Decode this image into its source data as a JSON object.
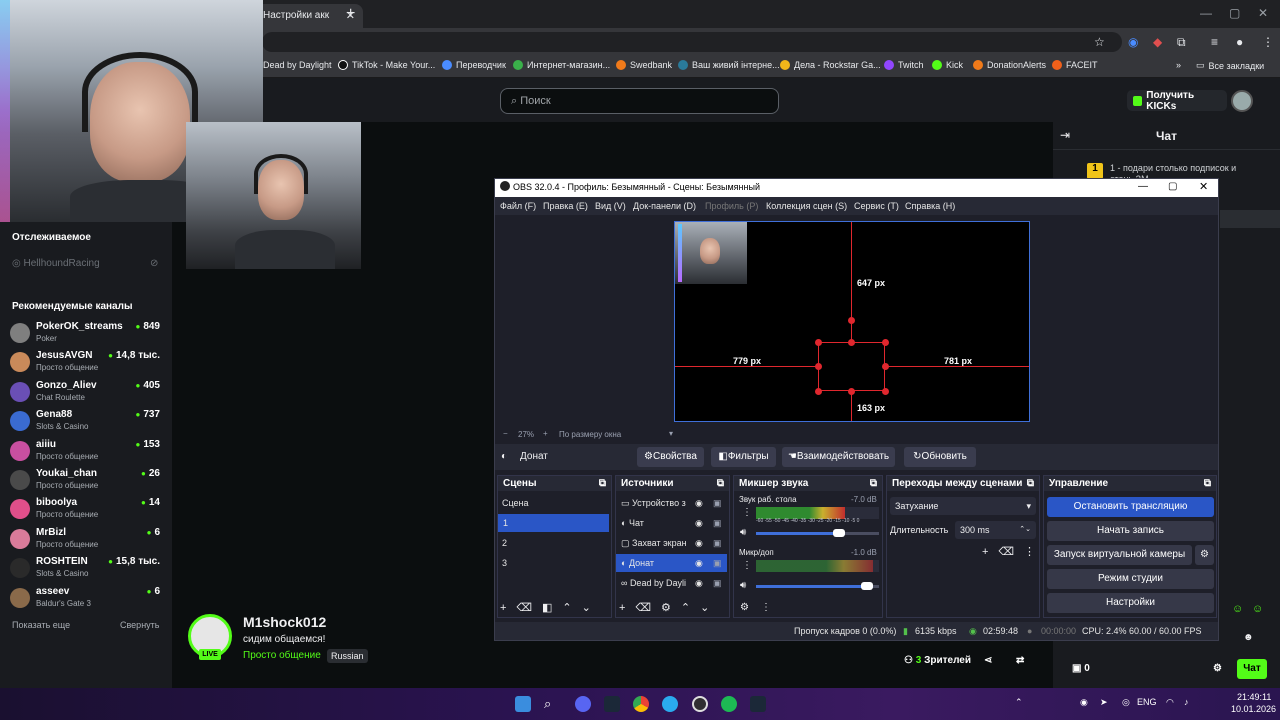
{
  "browser": {
    "tab_title": "Настройки акк",
    "new_tab": "+",
    "bookmarks": [
      "Dead by Daylight",
      "TikTok - Make Your...",
      "Переводчик",
      "Интернет-магазин...",
      "Swedbank",
      "Ваш живий інтерне...",
      "Дела - Rockstar Ga...",
      "Twitch",
      "Kick",
      "DonationAlerts",
      "FACEIT"
    ],
    "all_bookmarks": "Все закладки",
    "bookmarks_more": "»"
  },
  "kick": {
    "search_placeholder": "Поиск",
    "kicks_button": "Получить KICKs",
    "followed_title": "Отслеживаемое",
    "followed": [
      {
        "name": "HellhoundRacing"
      }
    ],
    "recommended_title": "Рекомендуемые каналы",
    "channels": [
      {
        "name": "PokerOK_streams",
        "category": "Poker",
        "viewers": "849",
        "color": "#7f7f7f"
      },
      {
        "name": "JesusAVGN",
        "category": "Просто общение",
        "viewers": "14,8 тыс.",
        "color": "#c98a5a"
      },
      {
        "name": "Gonzo_Aliev",
        "category": "Chat Roulette",
        "viewers": "405",
        "color": "#6a4fb5"
      },
      {
        "name": "Gena88",
        "category": "Slots & Casino",
        "viewers": "737",
        "color": "#3a6bd1"
      },
      {
        "name": "aiiiu",
        "category": "Просто общение",
        "viewers": "153",
        "color": "#c94fa0"
      },
      {
        "name": "Youkai_chan",
        "category": "Просто общение",
        "viewers": "26",
        "color": "#4a4a4a"
      },
      {
        "name": "biboolya",
        "category": "Просто общение",
        "viewers": "14",
        "color": "#e04f8a"
      },
      {
        "name": "MrBizl",
        "category": "Просто общение",
        "viewers": "6",
        "color": "#d97b9a"
      },
      {
        "name": "ROSHTEIN",
        "category": "Slots & Casino",
        "viewers": "15,8 тыс.",
        "color": "#2a2a2a"
      },
      {
        "name": "asseev",
        "category": "Baldur's Gate 3",
        "viewers": "6",
        "color": "#8a6a4a"
      }
    ],
    "show_more": "Показать еще",
    "collapse": "Свернуть",
    "chat_title": "Чат",
    "chat_pin": "1 - подари столько подписок и",
    "chat_pin2": "стань ЗМ",
    "streamer_name": "M1shock012",
    "stream_title": "сидим общаемся!",
    "stream_category": "Просто общение",
    "stream_language": "Russian",
    "live_badge": "LIVE",
    "viewers_count": "3",
    "viewers_label": "Зрителей",
    "kicks_count": "0",
    "chat_button": "Чат"
  },
  "obs": {
    "title": "OBS 32.0.4 - Профиль: Безымянный - Сцены: Безымянный",
    "menu": [
      "Файл (F)",
      "Правка (E)",
      "Вид (V)",
      "Док-панели (D)",
      "Профиль (P)",
      "Коллекция сцен (S)",
      "Сервис (T)",
      "Справка (H)"
    ],
    "px_top": "647 px",
    "px_left": "779 px",
    "px_right": "781 px",
    "px_bottom": "163 px",
    "zoom": "27%",
    "zoom_mode": "По размеру окна",
    "selected_source": "Донат",
    "btn_properties": "Свойства",
    "btn_filters": "Фильтры",
    "btn_interact": "Взаимодействовать",
    "btn_refresh": "Обновить",
    "scenes_title": "Сцены",
    "scenes": [
      "Сцена",
      "1",
      "2",
      "3"
    ],
    "sources_title": "Источники",
    "sources": [
      "Устройство з",
      "Чат",
      "Захват экран",
      "Донат",
      "Dead by Dayli"
    ],
    "mixer_title": "Микшер звука",
    "mixer": [
      {
        "name": "Звук раб. стола",
        "db": "-7.0 dB",
        "level": 0.72
      },
      {
        "name": "Микр/доп",
        "db": "-1.0 dB",
        "level": 0.95
      }
    ],
    "meter_scale": "-60 -55 -50 -45 -40 -35 -30 -25 -20 -15 -10 -5 0",
    "transitions_title": "Переходы между сценами",
    "transition": "Затухание",
    "duration_label": "Длительность",
    "duration": "300 ms",
    "controls_title": "Управление",
    "controls": [
      "Остановить трансляцию",
      "Начать запись",
      "Запуск виртуальной камеры",
      "Режим студии",
      "Настройки"
    ],
    "status": {
      "dropped": "Пропуск кадров 0 (0.0%)",
      "bitrate": "6135 kbps",
      "stream_time": "02:59:48",
      "rec_time": "00:00:00",
      "cpu": "CPU: 2.4%",
      "fps": "60.00 / 60.00 FPS"
    }
  },
  "taskbar": {
    "lang": "ENG",
    "time": "21:49:11",
    "date": "10.01.2026"
  }
}
